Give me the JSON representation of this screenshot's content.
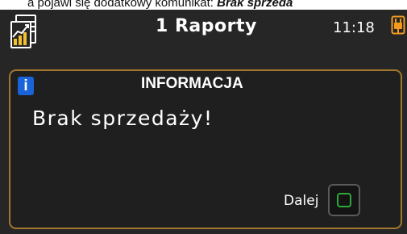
{
  "document_strip": {
    "text_before": "a pojawi się dodatkowy komunikat: ",
    "text_emphasis": "Brak sprzeda"
  },
  "header": {
    "app_icon": "reports-chart-icon",
    "title": "1 Raporty",
    "time": "11:18",
    "power_icon": "power-plug-icon"
  },
  "dialog": {
    "icon": "info-icon",
    "icon_text": "i",
    "title": "INFORMACJA",
    "message": "Brak sprzedaży!",
    "next_label": "Dalej"
  },
  "colors": {
    "screen_background": "#262626",
    "dialog_border": "#a0772d",
    "info_blue": "#1a63d8",
    "confirm_green": "#2ea83a",
    "power_orange": "#f29a1e"
  }
}
